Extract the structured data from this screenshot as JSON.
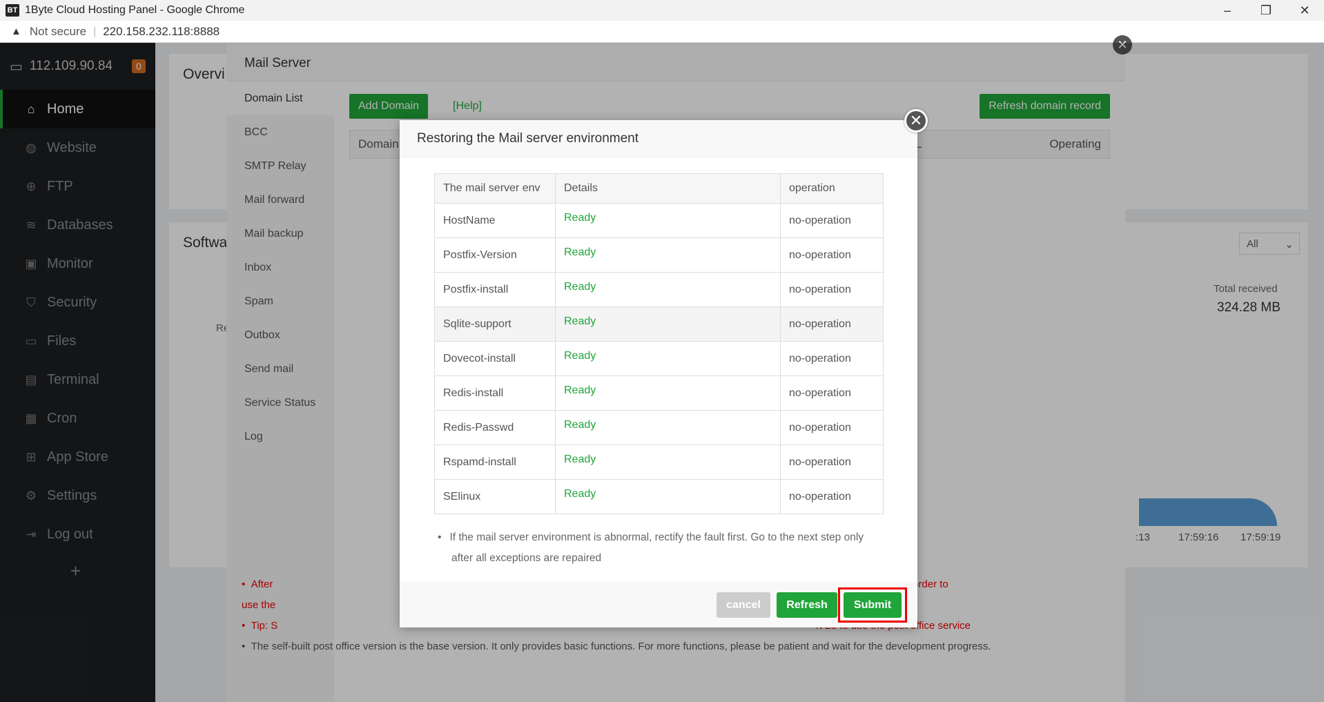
{
  "window": {
    "app_icon": "BT",
    "title": "1Byte Cloud Hosting Panel - Google Chrome",
    "min": "–",
    "restore": "❐",
    "close": "✕"
  },
  "address": {
    "warning": "▲",
    "not_secure": "Not secure",
    "separator": "|",
    "url": "220.158.232.118:8888"
  },
  "sidebar": {
    "server_ip": "112.109.90.84",
    "badge": "0",
    "items": [
      {
        "label": "Home",
        "icon": "home-icon",
        "glyph": "⌂"
      },
      {
        "label": "Website",
        "icon": "globe-icon",
        "glyph": "◍"
      },
      {
        "label": "FTP",
        "icon": "ftp-icon",
        "glyph": "⊕"
      },
      {
        "label": "Databases",
        "icon": "database-icon",
        "glyph": "≋"
      },
      {
        "label": "Monitor",
        "icon": "monitor-icon",
        "glyph": "▣"
      },
      {
        "label": "Security",
        "icon": "shield-icon",
        "glyph": "⛉"
      },
      {
        "label": "Files",
        "icon": "folder-icon",
        "glyph": "▭"
      },
      {
        "label": "Terminal",
        "icon": "terminal-icon",
        "glyph": "▤"
      },
      {
        "label": "Cron",
        "icon": "cron-icon",
        "glyph": "▦"
      },
      {
        "label": "App Store",
        "icon": "grid-icon",
        "glyph": "⊞"
      },
      {
        "label": "Settings",
        "icon": "gear-icon",
        "glyph": "⚙"
      },
      {
        "label": "Log out",
        "icon": "logout-icon",
        "glyph": "⇥"
      }
    ],
    "add": "+"
  },
  "background": {
    "overview": "Overvi",
    "software": "Softwa",
    "redis_partial": "Redi",
    "filter_all": "All",
    "total_received_label": "Total received",
    "total_received_value": "324.28 MB",
    "times": [
      ":13",
      "17:59:16",
      "17:59:19"
    ]
  },
  "mail_server": {
    "title": "Mail Server",
    "menu": [
      "Domain List",
      "BCC",
      "SMTP Relay",
      "Mail forward",
      "Mail backup",
      "Inbox",
      "Spam",
      "Outbox",
      "Send mail",
      "Service Status",
      "Log"
    ],
    "add_domain": "Add Domain",
    "help": "[Help]",
    "refresh_record": "Refresh domain record",
    "col_domain": "Domain",
    "col_l": "L",
    "col_operating": "Operating",
    "note1_start": "After",
    "note1_end": "anti-spam services) in order to",
    "note1_line2": "use the",
    "note2_start": "Tip: S",
    "note2_end": "rt 25 to use the post office service",
    "note3": "The self-built post office version is the base version. It only provides basic functions. For more functions, please be patient and wait for the development progress."
  },
  "dialog": {
    "title": "Restoring the Mail server environment",
    "headers": [
      "The mail server env",
      "Details",
      "operation"
    ],
    "rows": [
      {
        "env": "HostName",
        "details": "Ready",
        "operation": "no-operation"
      },
      {
        "env": "Postfix-Version",
        "details": "Ready",
        "operation": "no-operation"
      },
      {
        "env": "Postfix-install",
        "details": "Ready",
        "operation": "no-operation"
      },
      {
        "env": "Sqlite-support",
        "details": "Ready",
        "operation": "no-operation"
      },
      {
        "env": "Dovecot-install",
        "details": "Ready",
        "operation": "no-operation"
      },
      {
        "env": "Redis-install",
        "details": "Ready",
        "operation": "no-operation"
      },
      {
        "env": "Redis-Passwd",
        "details": "Ready",
        "operation": "no-operation"
      },
      {
        "env": "Rspamd-install",
        "details": "Ready",
        "operation": "no-operation"
      },
      {
        "env": "SElinux",
        "details": "Ready",
        "operation": "no-operation"
      }
    ],
    "tip": "If the mail server environment is abnormal, rectify the fault first. Go to the next step only after all exceptions are repaired",
    "cancel": "cancel",
    "refresh": "Refresh",
    "submit": "Submit"
  }
}
